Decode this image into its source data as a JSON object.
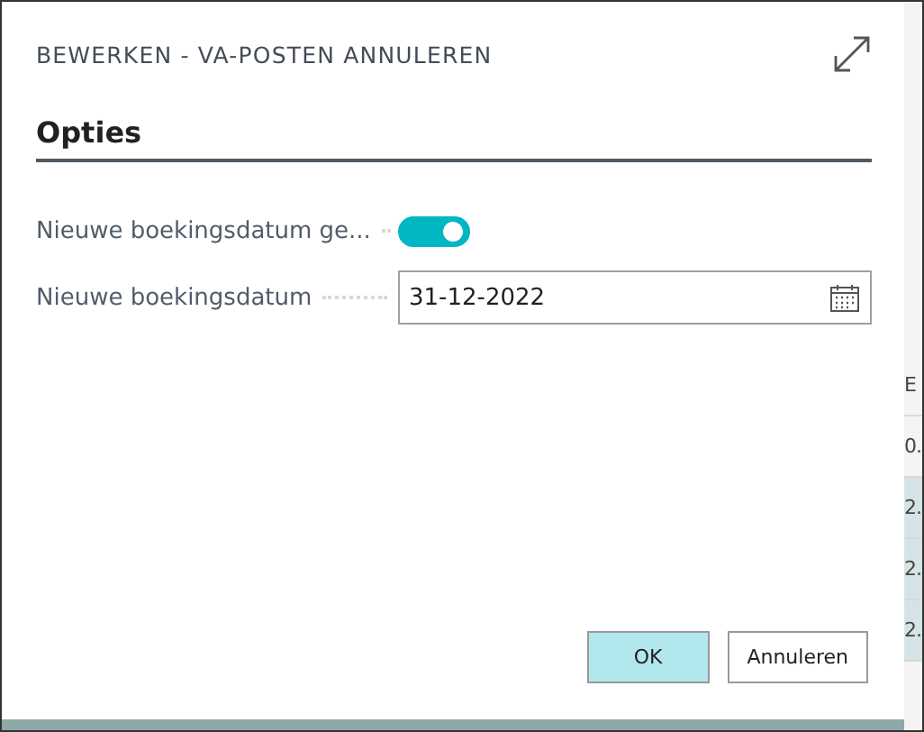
{
  "dialog": {
    "title": "BEWERKEN - VA-POSTEN ANNULEREN",
    "section": "Opties",
    "fields": [
      {
        "kind": "toggle",
        "label": "Nieuwe boekingsdatum ge...",
        "on": true
      },
      {
        "kind": "date",
        "label": "Nieuwe boekingsdatum",
        "value": "31-12-2022"
      }
    ],
    "buttons": [
      {
        "label": "OK",
        "primary": true
      },
      {
        "label": "Annuleren",
        "primary": false
      }
    ]
  },
  "background_table": {
    "header": "E",
    "cells": [
      {
        "text": "0.",
        "selected": false
      },
      {
        "text": "2.",
        "selected": true
      },
      {
        "text": "2.",
        "selected": true
      },
      {
        "text": "2.",
        "selected": true
      }
    ]
  }
}
